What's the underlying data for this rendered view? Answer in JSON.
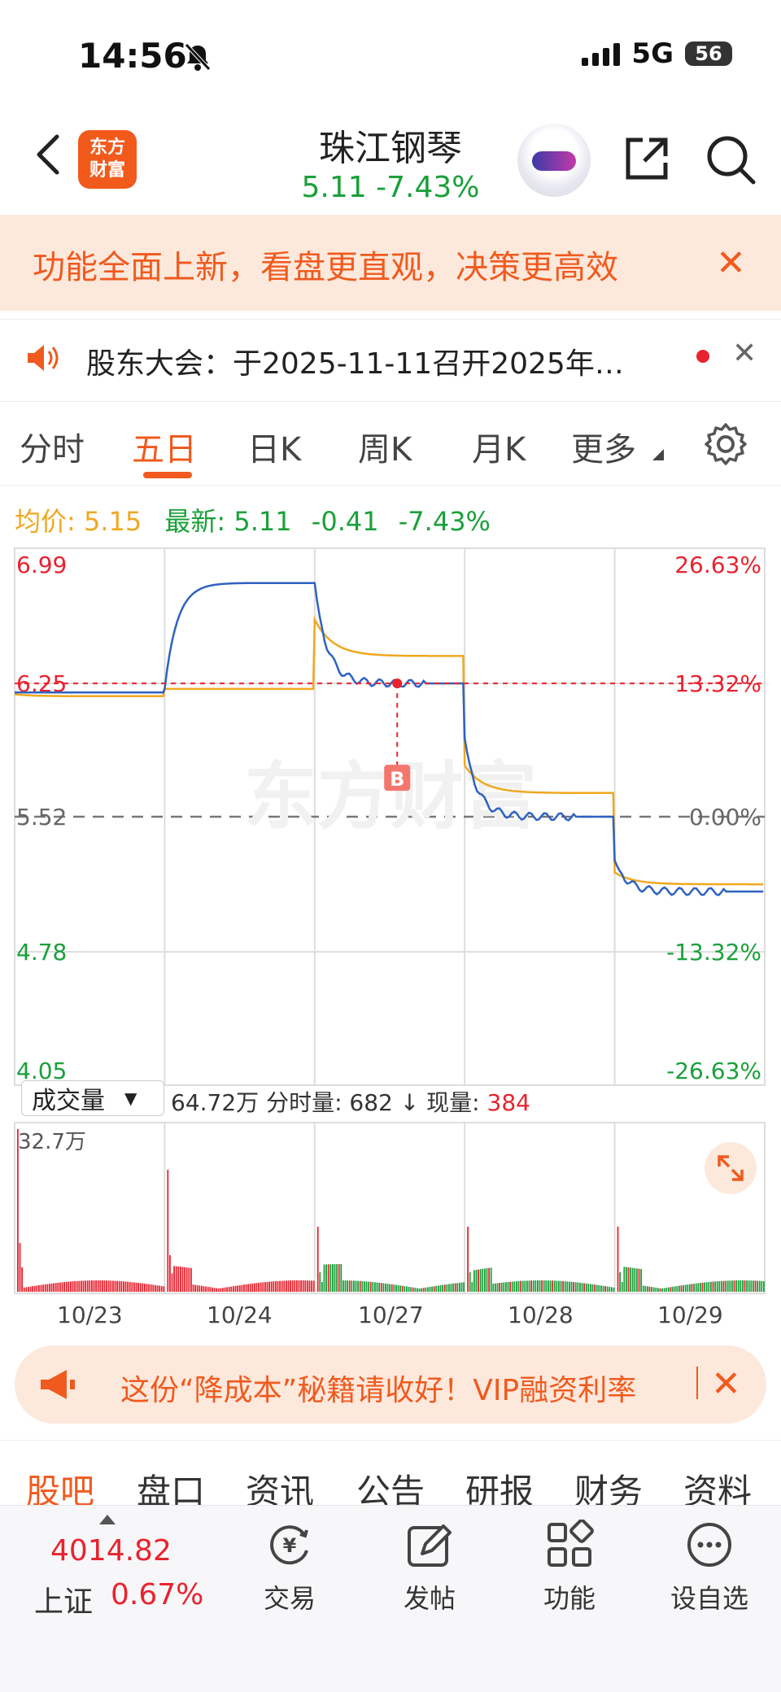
{
  "status_bar": {
    "time": "14:56",
    "network": "5G",
    "battery": "56"
  },
  "header": {
    "logo_line1": "东方",
    "logo_line2": "财富",
    "stock_name": "珠江钢琴",
    "quote": "5.11  -7.43%"
  },
  "promo_banner": {
    "text": "功能全面上新，看盘更直观，决策更高效",
    "close": "✕"
  },
  "notice": {
    "text": "股东大会：于2025-11-11召开2025年…",
    "close": "✕"
  },
  "tabs": [
    "分时",
    "五日",
    "日K",
    "周K",
    "月K",
    "更多"
  ],
  "active_tab": "五日",
  "info_line": {
    "avg_label": "均价:",
    "avg_value": "5.15",
    "latest_label": "最新:",
    "latest_value": "5.11",
    "change": "-0.41",
    "pct": "-7.43%"
  },
  "chart_data": {
    "type": "line",
    "price_axis": {
      "labels_left": [
        "6.99",
        "6.25",
        "5.52",
        "4.78",
        "4.05"
      ],
      "labels_right": [
        "26.63%",
        "13.32%",
        "0.00%",
        "-13.32%",
        "-26.63%"
      ],
      "ylim": [
        4.05,
        6.99
      ],
      "prev_close": 5.52
    },
    "x": [
      "10/23",
      "10/24",
      "10/27",
      "10/28",
      "10/29"
    ],
    "series": [
      {
        "values": [
          6.2,
          6.8,
          6.25,
          5.52,
          5.11
        ]
      },
      {
        "values": [
          6.18,
          6.22,
          6.4,
          5.65,
          5.15
        ]
      }
    ],
    "marker": "B",
    "marker_price": 6.25,
    "watermark": "东方财富"
  },
  "volume": {
    "selector": "成交量",
    "total": "64.72万",
    "tick_label": "分时量:",
    "tick_value": "682",
    "arrow": "↓",
    "now_label": "现量:",
    "now_value": "384",
    "max_label": "32.7万"
  },
  "ad": {
    "text": "这份“降成本”秘籍请收好！VIP融资利率",
    "close": "✕"
  },
  "section_tabs": [
    "股吧",
    "盘口",
    "资讯",
    "公告",
    "研报",
    "财务",
    "资料"
  ],
  "bottom_nav": {
    "index_value": "4014.82",
    "index_name": "上证",
    "index_pct": "0.67%",
    "items": [
      {
        "label": "交易",
        "icon": "yuan-cycle-icon"
      },
      {
        "label": "发帖",
        "icon": "edit-icon"
      },
      {
        "label": "功能",
        "icon": "grid-icon"
      },
      {
        "label": "设自选",
        "icon": "more-dots-icon"
      }
    ]
  },
  "colors": {
    "accent": "#f05a1e",
    "up": "#e8232f",
    "down": "#1aa03a",
    "avg": "#f0a820",
    "price": "#2f62c0"
  }
}
